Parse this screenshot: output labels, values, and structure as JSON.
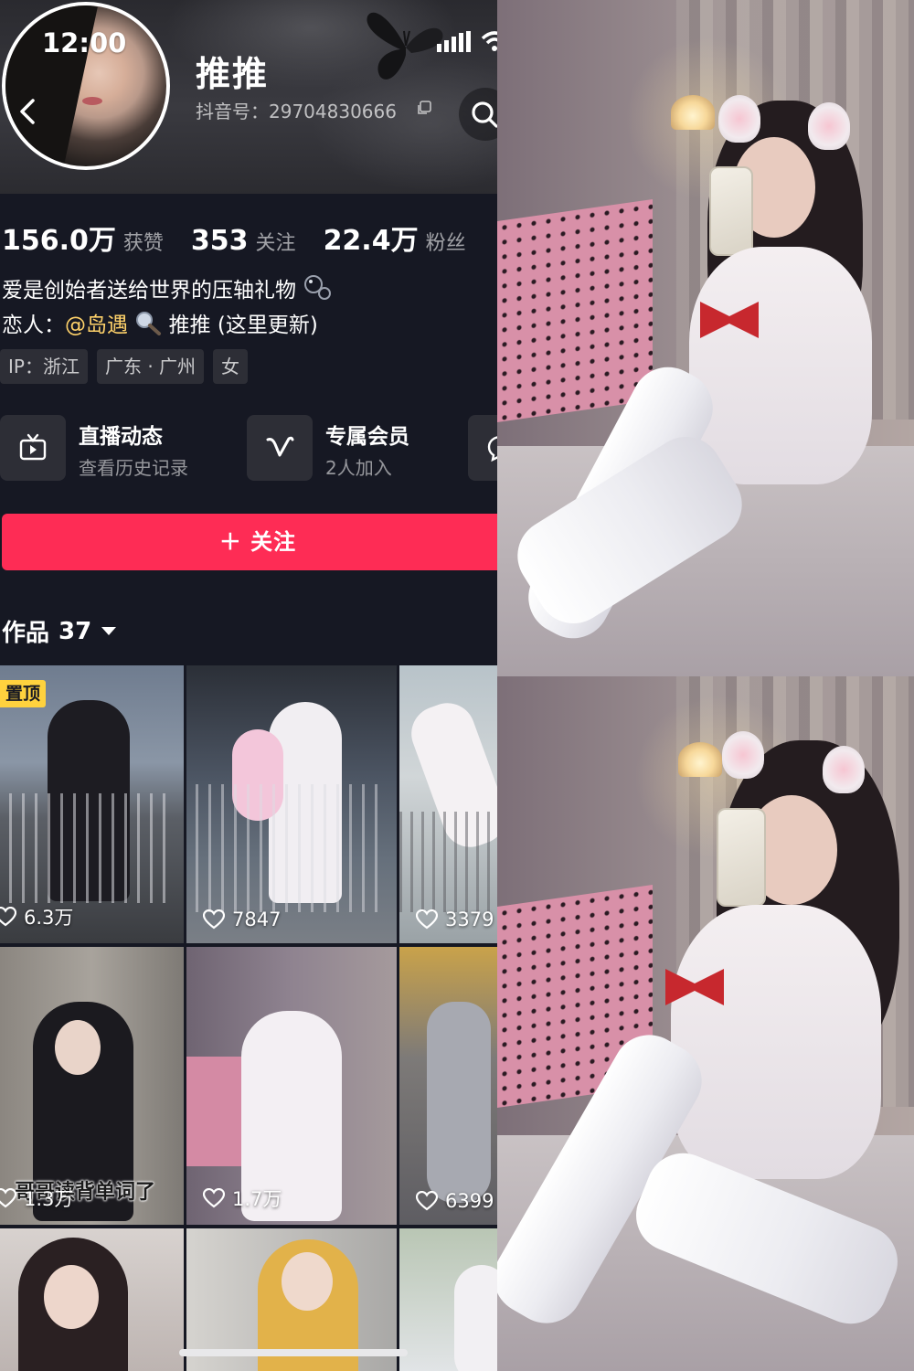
{
  "status_bar": {
    "time": "12:00"
  },
  "profile": {
    "nickname": "推推",
    "douyin_id": "抖音号：29704830666",
    "stats": [
      {
        "value": "156.0万",
        "label": "获赞"
      },
      {
        "value": "353",
        "label": "关注"
      },
      {
        "value": "22.4万",
        "label": "粉丝"
      }
    ],
    "bio_line1": "爱是创始者送给世界的压轴礼物",
    "bio_line2_prefix": "恋人：",
    "bio_line2_mention": "@岛遇",
    "bio_line2_suffix": "推推 (这里更新)",
    "tags": [
      "IP：浙江",
      "广东 · 广州",
      "女"
    ]
  },
  "services": [
    {
      "title": "直播动态",
      "subtitle": "查看历史记录",
      "icon": "tv-icon"
    },
    {
      "title": "专属会员",
      "subtitle": "2人加入",
      "icon": "v-icon"
    }
  ],
  "follow_button": "＋ 关注",
  "works_tab": {
    "label": "作品",
    "count": "37"
  },
  "videos": [
    {
      "likes": "6.3万",
      "badge": "置顶"
    },
    {
      "likes": "7847"
    },
    {
      "likes": "3379"
    },
    {
      "likes": "1.3万",
      "caption": "哥哥读背单词了"
    },
    {
      "likes": "1.7万"
    },
    {
      "likes": "6399"
    },
    {},
    {},
    {}
  ],
  "colors": {
    "background": "#161823",
    "follow_button": "#fe2c55",
    "mention": "#ffd26a",
    "pin_badge": "#ffd23e"
  }
}
